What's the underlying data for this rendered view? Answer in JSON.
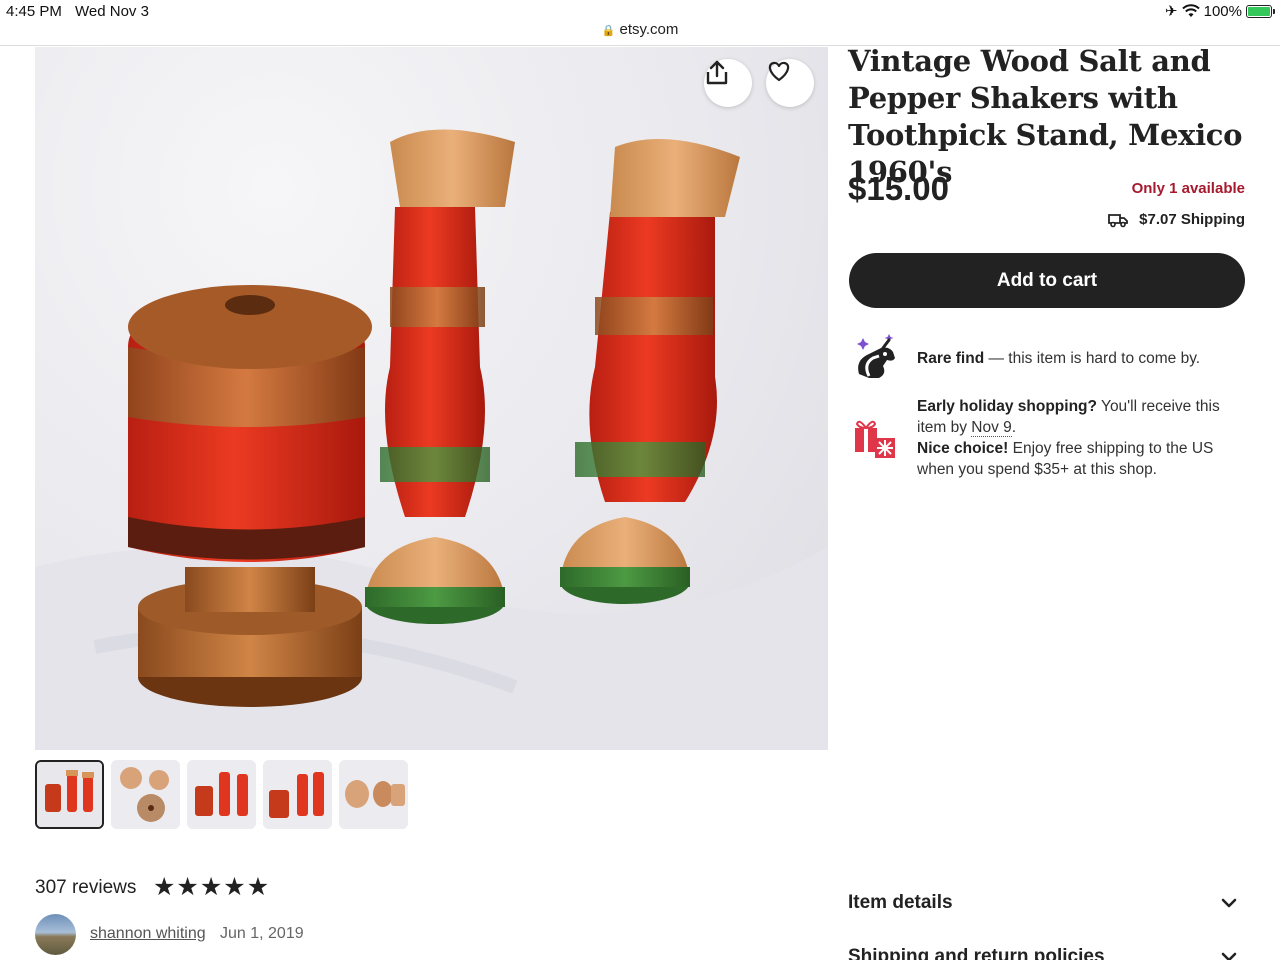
{
  "status_bar": {
    "time": "4:45 PM",
    "date": "Wed Nov 3",
    "url": "etsy.com",
    "battery": "100%"
  },
  "listing": {
    "title": "Vintage Wood Salt and Pepper Shakers with Toothpick Stand, Mexico 1960's",
    "price": "$15.00",
    "availability": "Only 1 available",
    "shipping": "$7.07 Shipping",
    "add_to_cart": "Add to cart",
    "thumbnail_count": 5,
    "active_thumbnail": 0
  },
  "highlights": {
    "rare_label": "Rare find",
    "rare_text": " — this item is hard to come by.",
    "holiday_label": "Early holiday shopping?",
    "holiday_text": " You'll receive this item by ",
    "holiday_date": "Nov 9",
    "holiday_end": ".",
    "nice_label": "Nice choice!",
    "nice_text": " Enjoy free shipping to the US when you spend $35+ at this shop."
  },
  "reviews": {
    "count_label": "307 reviews",
    "rating": 5,
    "reviewer_name": "shannon whiting",
    "review_date": "Jun 1, 2019"
  },
  "accordion": {
    "item_details": "Item details",
    "shipping_policies": "Shipping and return policies"
  },
  "colors": {
    "accent": "#a61a2e",
    "button": "#222222",
    "battery": "#34c759"
  }
}
